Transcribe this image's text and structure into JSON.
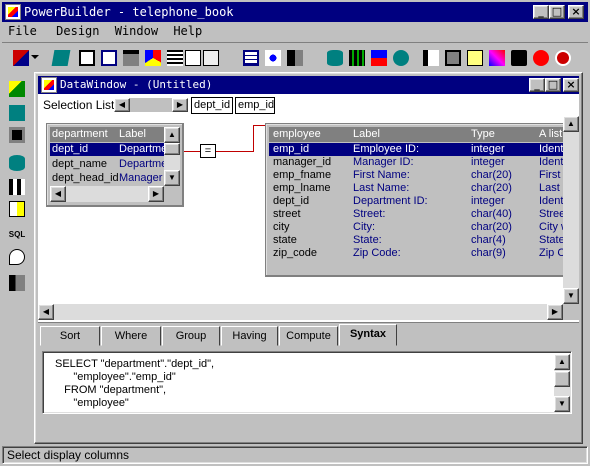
{
  "app": {
    "title": "PowerBuilder - telephone_book",
    "minimize": "_",
    "maximize": "□",
    "close": "×"
  },
  "menu": [
    "File",
    "Design",
    "Window",
    "Help"
  ],
  "toolbar_icons": [
    "new-icon",
    "dropdown-arrow-icon",
    "open-icon",
    "application-icon",
    "window-icon",
    "menu-icon",
    "datawindow-icon",
    "structure-icon",
    "function-icon",
    "query-icon",
    "pipeline-icon",
    "project-icon",
    "user-object-icon",
    "database-icon",
    "db-profile-icon",
    "library-icon",
    "run-icon",
    "debug-icon",
    "browser-icon",
    "library-painter-icon",
    "edit-icon",
    "exit-icon",
    "help-icon",
    "stop-icon"
  ],
  "left_toolbar_icons": [
    "new-datawindow-icon",
    "open-icon",
    "save-icon",
    "table-icon",
    "join-icon",
    "tables-list-icon",
    "sql-icon",
    "preview-icon",
    "exit-painter-icon"
  ],
  "left_toolbar_sql": "SQL",
  "dw": {
    "title": "DataWindow - (Untitled)",
    "selection_label": "Selection List:",
    "selected_columns": [
      "dept_id",
      "emp_id"
    ]
  },
  "department_table": {
    "headers": [
      "department",
      "Label"
    ],
    "rows": [
      {
        "col": "dept_id",
        "label": "Departme"
      },
      {
        "col": "dept_name",
        "label": "Departme"
      },
      {
        "col": "dept_head_id",
        "label": "Manager"
      }
    ]
  },
  "join_operator": "=",
  "employee_table": {
    "headers": [
      "employee",
      "Label",
      "Type",
      "A list"
    ],
    "rows": [
      {
        "col": "emp_id",
        "label": "Employee ID:",
        "type": "integer",
        "alist": "Identi"
      },
      {
        "col": "manager_id",
        "label": "Manager ID:",
        "type": "integer",
        "alist": "Identi"
      },
      {
        "col": "emp_fname",
        "label": "First Name:",
        "type": "char(20)",
        "alist": "First n"
      },
      {
        "col": "emp_lname",
        "label": "Last Name:",
        "type": "char(20)",
        "alist": "Last n"
      },
      {
        "col": "dept_id",
        "label": "Department ID:",
        "type": "integer",
        "alist": "Identi"
      },
      {
        "col": "street",
        "label": "Street:",
        "type": "char(40)",
        "alist": "Stree"
      },
      {
        "col": "city",
        "label": "City:",
        "type": "char(20)",
        "alist": "City w"
      },
      {
        "col": "state",
        "label": "State:",
        "type": "char(4)",
        "alist": "State"
      },
      {
        "col": "zip_code",
        "label": "Zip Code:",
        "type": "char(9)",
        "alist": "Zip C"
      }
    ]
  },
  "tabs": [
    "Sort",
    "Where",
    "Group",
    "Having",
    "Compute",
    "Syntax"
  ],
  "active_tab": "Syntax",
  "syntax_lines": [
    "SELECT \"department\".\"dept_id\",",
    "      \"employee\".\"emp_id\"",
    "   FROM \"department\",",
    "      \"employee\""
  ],
  "status": "Select display columns",
  "colors": {
    "titlebar": "#000080",
    "face": "#c0c0c0",
    "selection": "#000080",
    "join_line": "#c00000"
  }
}
